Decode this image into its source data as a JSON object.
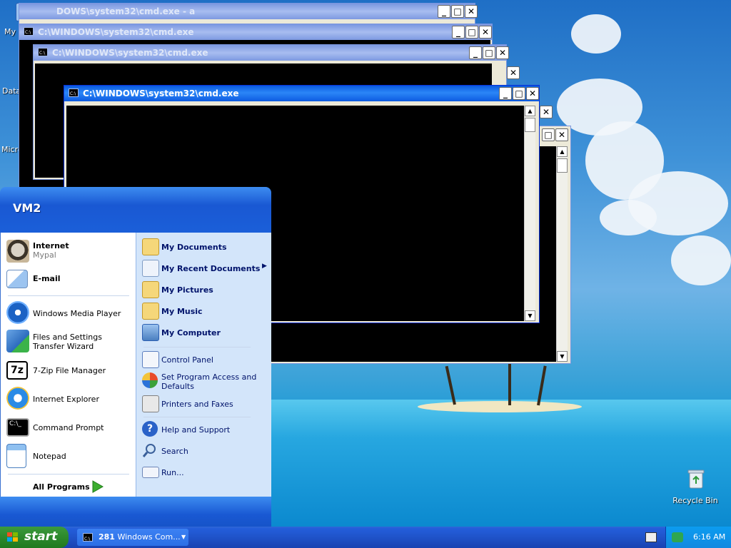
{
  "desktop": {
    "icons": {
      "my_computer": "My",
      "data": "Data",
      "micro": "Micro",
      "recycle_bin": "Recycle Bin"
    }
  },
  "windows": [
    {
      "title": "DOWS\\system32\\cmd.exe - a"
    },
    {
      "title": "C:\\WINDOWS\\system32\\cmd.exe"
    },
    {
      "title": "C:\\WINDOWS\\system32\\cmd.exe"
    },
    {
      "title": "C:\\WINDOWS\\system32\\cmd.exe"
    }
  ],
  "window_controls": {
    "minimize": "_",
    "maximize": "□",
    "close": "✕"
  },
  "start_menu": {
    "user": "VM2",
    "pinned": [
      {
        "label": "Internet",
        "sub": "Mypal"
      },
      {
        "label": "E-mail"
      }
    ],
    "recent": [
      {
        "label": "Windows Media Player"
      },
      {
        "label": "Files and Settings Transfer Wizard"
      },
      {
        "label": "7-Zip File Manager"
      },
      {
        "label": "Internet Explorer"
      },
      {
        "label": "Command Prompt"
      },
      {
        "label": "Notepad"
      }
    ],
    "all_programs": "All Programs",
    "places": [
      {
        "label": "My Documents"
      },
      {
        "label": "My Recent Documents"
      },
      {
        "label": "My Pictures"
      },
      {
        "label": "My Music"
      },
      {
        "label": "My Computer"
      }
    ],
    "settings": [
      {
        "label": "Control Panel"
      },
      {
        "label": "Set Program Access and Defaults"
      },
      {
        "label": "Printers and Faxes"
      }
    ],
    "help": [
      {
        "label": "Help and Support"
      },
      {
        "label": "Search"
      },
      {
        "label": "Run..."
      }
    ]
  },
  "taskbar": {
    "start_label": "start",
    "task_group": {
      "count": "281",
      "label": "Windows Com..."
    },
    "clock": "6:16 AM"
  },
  "colors": {
    "title_active": "#0a5ae0",
    "start_green": "#2f8c2f",
    "taskbar_blue": "#245edb"
  }
}
